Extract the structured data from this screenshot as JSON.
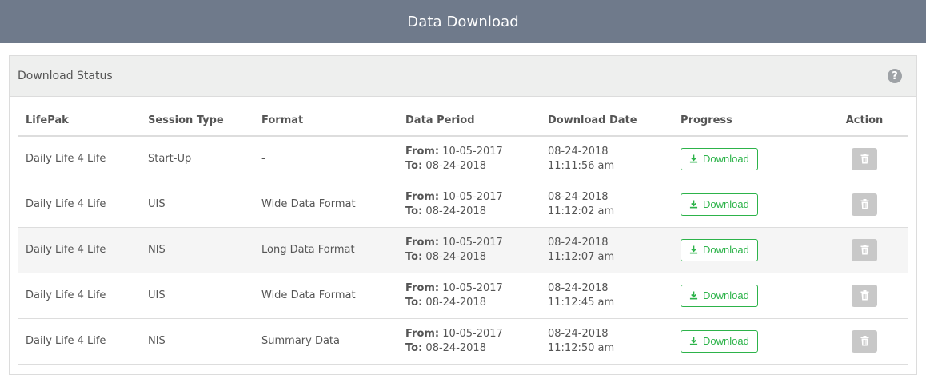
{
  "header": {
    "title": "Data Download"
  },
  "panel": {
    "title": "Download Status",
    "help_icon": "question-circle-icon",
    "help_glyph": "?"
  },
  "table": {
    "columns": [
      "LifePak",
      "Session Type",
      "Format",
      "Data Period",
      "Download Date",
      "Progress",
      "Action"
    ],
    "rows": [
      {
        "lifepak": "Daily Life 4 Life",
        "session": "Start-Up",
        "format": "-",
        "from_label": "From:",
        "from": "10-05-2017",
        "to_label": "To:",
        "to": "08-24-2018",
        "date": "08-24-2018",
        "time": "11:11:56 am",
        "progress": "Download"
      },
      {
        "lifepak": "Daily Life 4 Life",
        "session": "UIS",
        "format": "Wide Data Format",
        "from_label": "From:",
        "from": "10-05-2017",
        "to_label": "To:",
        "to": "08-24-2018",
        "date": "08-24-2018",
        "time": "11:12:02 am",
        "progress": "Download"
      },
      {
        "lifepak": "Daily Life 4 Life",
        "session": "NIS",
        "format": "Long Data Format",
        "from_label": "From:",
        "from": "10-05-2017",
        "to_label": "To:",
        "to": "08-24-2018",
        "date": "08-24-2018",
        "time": "11:12:07 am",
        "progress": "Download"
      },
      {
        "lifepak": "Daily Life 4 Life",
        "session": "UIS",
        "format": "Wide Data Format",
        "from_label": "From:",
        "from": "10-05-2017",
        "to_label": "To:",
        "to": "08-24-2018",
        "date": "08-24-2018",
        "time": "11:12:45 am",
        "progress": "Download"
      },
      {
        "lifepak": "Daily Life 4 Life",
        "session": "NIS",
        "format": "Summary Data",
        "from_label": "From:",
        "from": "10-05-2017",
        "to_label": "To:",
        "to": "08-24-2018",
        "date": "08-24-2018",
        "time": "11:12:50 am",
        "progress": "Download"
      }
    ]
  },
  "colors": {
    "topbar": "#6f7a8b",
    "download_accent": "#2db34a",
    "delete_button": "#c8c8c8"
  }
}
